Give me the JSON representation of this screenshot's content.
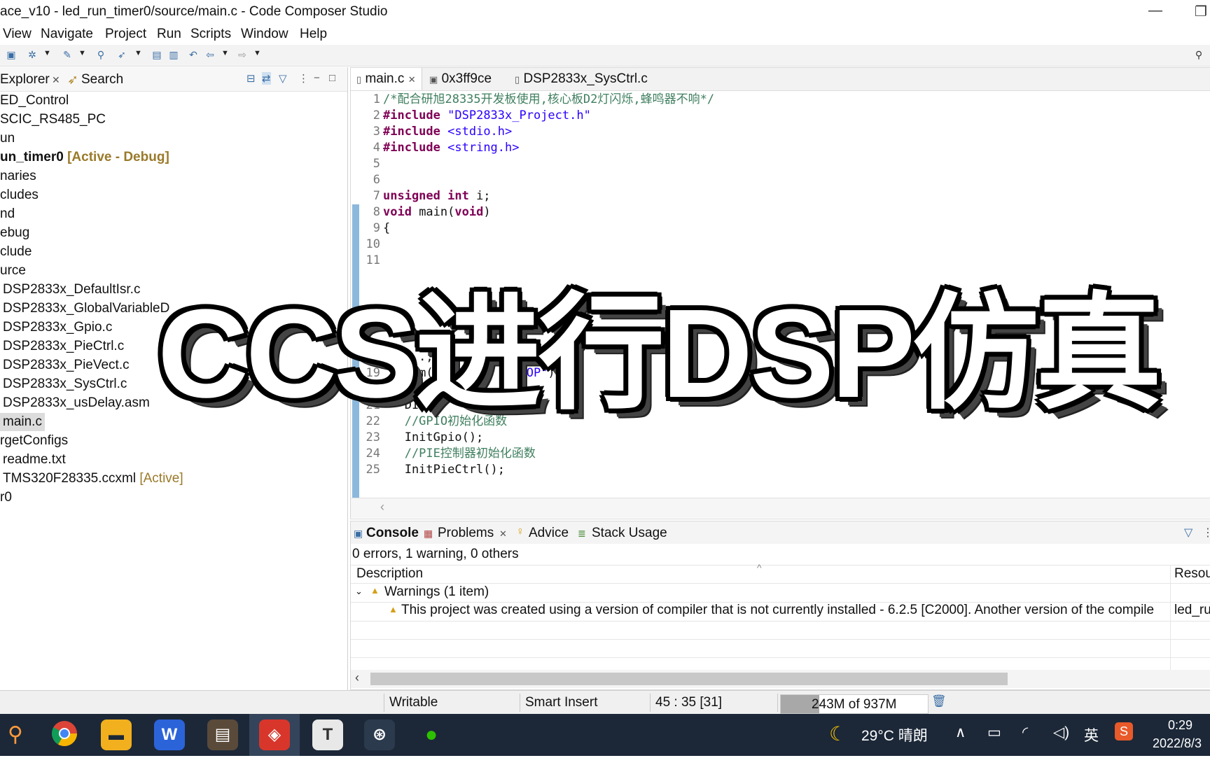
{
  "window": {
    "title": "ace_v10 - led_run_timer0/source/main.c - Code Composer Studio",
    "minimize": "—",
    "restore": "❐"
  },
  "menu": [
    "View",
    "Navigate",
    "Project",
    "Run",
    "Scripts",
    "Window",
    "Help"
  ],
  "left_tabs": {
    "explorer": "Explorer",
    "search": "Search"
  },
  "tree": [
    {
      "label": "ED_Control"
    },
    {
      "label": "SCIC_RS485_PC"
    },
    {
      "label": "un"
    },
    {
      "label": "un_timer0",
      "decor": "[Active - Debug]"
    },
    {
      "label": "naries"
    },
    {
      "label": "cludes"
    },
    {
      "label": "nd"
    },
    {
      "label": "ebug"
    },
    {
      "label": "clude"
    },
    {
      "label": "urce"
    },
    {
      "label": "DSP2833x_DefaultIsr.c"
    },
    {
      "label": "DSP2833x_GlobalVariableD"
    },
    {
      "label": "DSP2833x_Gpio.c"
    },
    {
      "label": "DSP2833x_PieCtrl.c"
    },
    {
      "label": "DSP2833x_PieVect.c"
    },
    {
      "label": "DSP2833x_SysCtrl.c"
    },
    {
      "label": "DSP2833x_usDelay.asm"
    },
    {
      "label": "main.c"
    },
    {
      "label": "rgetConfigs"
    },
    {
      "label": "readme.txt"
    },
    {
      "label": "TMS320F28335.ccxml",
      "decor": "[Active]"
    },
    {
      "label": "r0"
    }
  ],
  "editor_tabs": [
    "main.c",
    "0x3ff9ce",
    "DSP2833x_SysCtrl.c"
  ],
  "code": {
    "l1": "/*配合研旭28335开发板使用,核心板D2灯闪烁,蜂鸣器不响*/",
    "l2a": "#include",
    "l2b": "\"DSP2833x_Project.h\"",
    "l3a": "#include",
    "l3b": "<stdio.h>",
    "l4a": "#include",
    "l4b": "<string.h>",
    "l7a": "unsigned int",
    "l7b": " i;",
    "l8a": "void",
    "l8b": " main(",
    "l8c": "void",
    "l8d": ")",
    "l9": "{",
    "l18": "   ...;",
    "l19a": "   asm(",
    "l19b": "\" RPT #8 || NOP\"",
    "l19c": ");",
    "l21": "   DINT;",
    "l22": "   //GPIO初始化函数",
    "l23": "   InitGpio();",
    "l24": "   //PIE控制器初始化函数",
    "l25": "   InitPieCtrl();"
  },
  "line_numbers": [
    "1",
    "2",
    "3",
    "4",
    "5",
    "6",
    "7",
    "8",
    "9",
    "10",
    "11",
    "18",
    "19",
    "20",
    "21",
    "22",
    "23",
    "24",
    "25"
  ],
  "console": {
    "tabs": [
      "Console",
      "Problems",
      "Advice",
      "Stack Usage"
    ],
    "summary": "0 errors, 1 warning, 0 others",
    "col_description": "Description",
    "col_resource": "Resou",
    "group": "Warnings (1 item)",
    "warning": "This project was created using a version of compiler that is not currently installed - 6.2.5 [C2000]. Another version of the compile",
    "warning_resource": "led_ru"
  },
  "status": {
    "writable": "Writable",
    "insert": "Smart Insert",
    "position": "45 : 35 [31]",
    "heap": "243M of 937M",
    "heap_fraction": 0.26
  },
  "taskbar": {
    "weather": "29°C 晴朗",
    "lang": "英",
    "time": "0:29",
    "date": "2022/8/3"
  },
  "overlay": "CCS进行DSP仿真",
  "colors": {
    "accent": "#3a6ea5",
    "taskbar": "#1c2838"
  }
}
